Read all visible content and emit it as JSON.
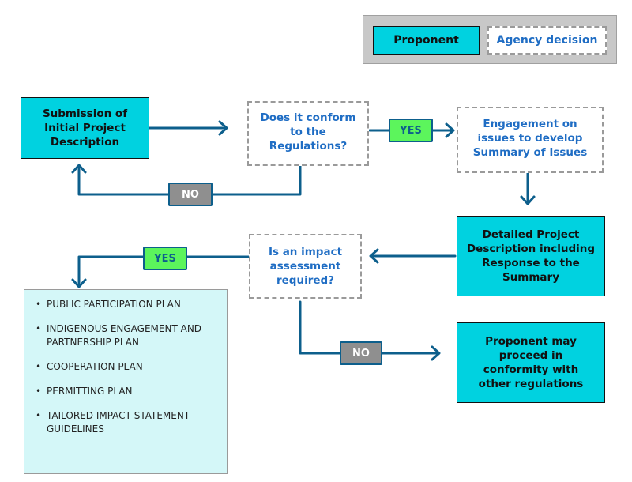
{
  "legend": {
    "proponent_label": "Proponent",
    "agency_label": "Agency decision"
  },
  "nodes": {
    "submission": "Submission of Initial Project Description",
    "conform_question": "Does it conform to the Regulations?",
    "engagement": "Engagement on issues to develop Summary of Issues",
    "detailed_description": "Detailed Project Description including Response to the Summary",
    "impact_question": "Is an impact assessment required?",
    "proceed": "Proponent may proceed in conformity with other regulations"
  },
  "edge_labels": {
    "conform_yes": "YES",
    "conform_no": "NO",
    "impact_yes": "YES",
    "impact_no": "NO"
  },
  "plans": [
    "PUBLIC PARTICIPATION PLAN",
    "INDIGENOUS ENGAGEMENT AND PARTNERSHIP PLAN",
    "COOPERATION PLAN",
    "PERMITTING PLAN",
    "TAILORED IMPACT STATEMENT GUIDELINES"
  ],
  "colors": {
    "proponent_fill": "#00d2e0",
    "agency_text": "#1f6dc4",
    "connector": "#0d5f8c",
    "yes_fill": "#5cf55c",
    "no_fill": "#8f8f8f",
    "list_fill": "#d4f7f8"
  }
}
